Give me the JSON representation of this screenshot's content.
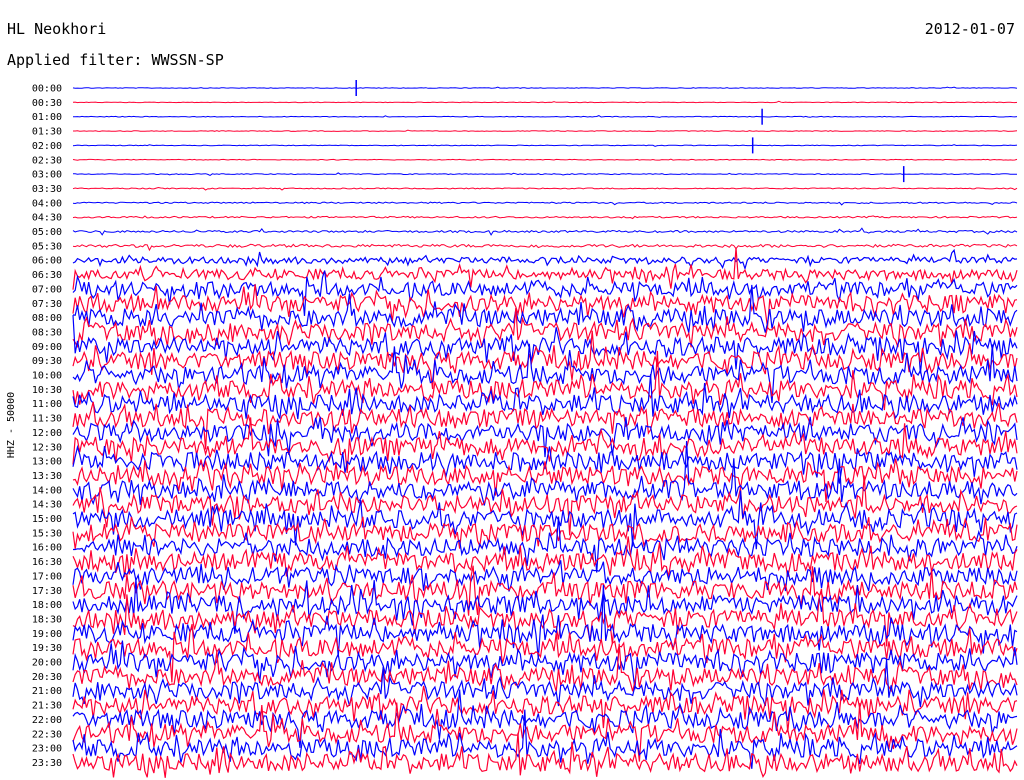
{
  "header": {
    "station": "HL Neokhori",
    "filter": "Applied filter: WWSSN-SP",
    "date": "2012-01-07"
  },
  "chart_data": {
    "type": "line",
    "title": "HL Neokhori",
    "ylabel": "HHZ - 50000",
    "row_labels": [
      "00:00",
      "00:30",
      "01:00",
      "01:30",
      "02:00",
      "02:30",
      "03:00",
      "03:30",
      "04:00",
      "04:30",
      "05:00",
      "05:30",
      "06:00",
      "06:30",
      "07:00",
      "07:30",
      "08:00",
      "08:30",
      "09:00",
      "09:30",
      "10:00",
      "10:30",
      "11:00",
      "11:30",
      "12:00",
      "12:30",
      "13:00",
      "13:30",
      "14:00",
      "14:30",
      "15:00",
      "15:30",
      "16:00",
      "16:30",
      "17:00",
      "17:30",
      "18:00",
      "18:30",
      "19:00",
      "19:30",
      "20:00",
      "20:30",
      "21:00",
      "21:30",
      "22:00",
      "22:30",
      "23:00",
      "23:30"
    ],
    "trace_colors": [
      "#0000ff",
      "#ff0033"
    ],
    "noise_level_by_row": [
      0.3,
      0.3,
      0.35,
      0.35,
      0.35,
      0.35,
      0.4,
      0.5,
      0.7,
      0.8,
      1,
      1.5,
      3,
      5,
      7,
      8,
      9,
      9,
      9,
      9,
      9,
      9,
      9,
      9,
      9,
      9,
      9,
      9,
      9,
      9,
      9,
      9,
      9,
      9,
      9,
      9,
      9,
      9,
      9,
      9,
      9,
      9,
      9,
      9,
      9,
      9,
      9,
      9
    ],
    "annotations": [
      {
        "row": "00:00",
        "x_fraction": 0.3,
        "label": "event burst"
      },
      {
        "row": "01:00",
        "x_fraction": 0.73,
        "label": "event burst"
      },
      {
        "row": "02:00",
        "x_fraction": 0.72,
        "label": "event burst"
      },
      {
        "row": "03:00",
        "x_fraction": 0.88,
        "label": "event burst"
      }
    ],
    "grid": false
  }
}
